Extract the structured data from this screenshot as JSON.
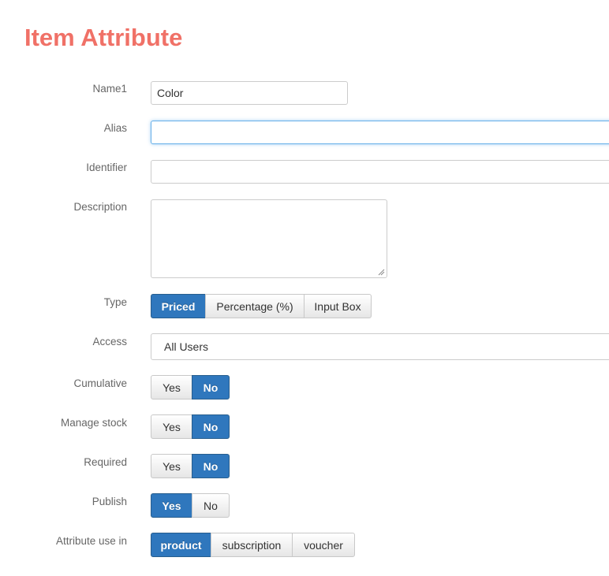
{
  "page": {
    "title": "Item Attribute"
  },
  "fields": {
    "name1": {
      "label": "Name1",
      "value": "Color"
    },
    "alias": {
      "label": "Alias",
      "value": ""
    },
    "identifier": {
      "label": "Identifier",
      "value": ""
    },
    "description": {
      "label": "Description",
      "value": ""
    },
    "type": {
      "label": "Type",
      "options": [
        "Priced",
        "Percentage (%)",
        "Input Box"
      ],
      "selected": "Priced"
    },
    "access": {
      "label": "Access",
      "value": "All Users"
    },
    "cumulative": {
      "label": "Cumulative",
      "options": [
        "Yes",
        "No"
      ],
      "selected": "No"
    },
    "manage_stock": {
      "label": "Manage stock",
      "options": [
        "Yes",
        "No"
      ],
      "selected": "No"
    },
    "required": {
      "label": "Required",
      "options": [
        "Yes",
        "No"
      ],
      "selected": "No"
    },
    "publish": {
      "label": "Publish",
      "options": [
        "Yes",
        "No"
      ],
      "selected": "Yes"
    },
    "attribute_use_in": {
      "label": "Attribute use in",
      "options": [
        "product",
        "subscription",
        "voucher"
      ],
      "selected": "product"
    }
  },
  "colors": {
    "title": "#f07167",
    "active_button": "#2f77bd",
    "focus_border": "#66afe9"
  }
}
